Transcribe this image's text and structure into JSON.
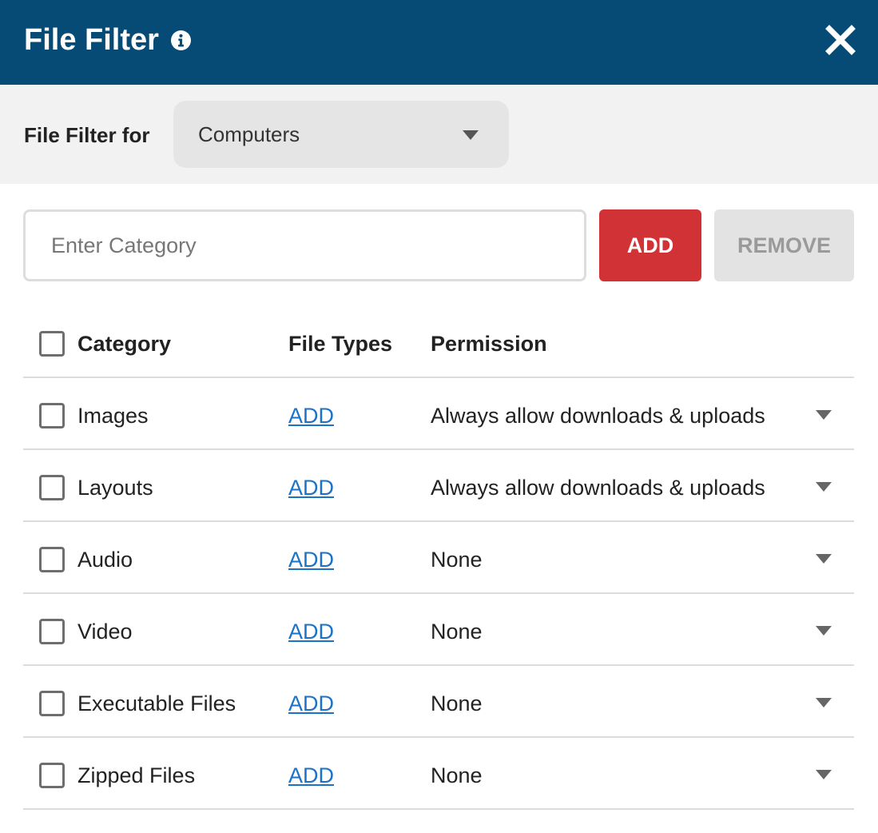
{
  "header": {
    "title": "File Filter",
    "background": "#064b75",
    "info_icon": "info-icon",
    "close_icon": "close-icon"
  },
  "filter_for": {
    "label": "File Filter for",
    "selected": "Computers",
    "caret_icon": "caret-down-icon"
  },
  "category_input": {
    "placeholder": "Enter Category",
    "value": ""
  },
  "buttons": {
    "add_label": "ADD",
    "add_color": "#d13235",
    "remove_label": "REMOVE",
    "remove_disabled": true
  },
  "table": {
    "headers": {
      "category": "Category",
      "file_types": "File Types",
      "permission": "Permission"
    },
    "rows": [
      {
        "category": "Images",
        "file_types": "ADD",
        "permission": "Always allow downloads & uploads"
      },
      {
        "category": "Layouts",
        "file_types": "ADD",
        "permission": "Always allow downloads & uploads"
      },
      {
        "category": "Audio",
        "file_types": "ADD",
        "permission": "None"
      },
      {
        "category": "Video",
        "file_types": "ADD",
        "permission": "None"
      },
      {
        "category": "Executable Files",
        "file_types": "ADD",
        "permission": "None"
      },
      {
        "category": "Zipped Files",
        "file_types": "ADD",
        "permission": "None"
      }
    ]
  },
  "colors": {
    "link": "#1a73c8",
    "divider": "#dcdcdc"
  }
}
